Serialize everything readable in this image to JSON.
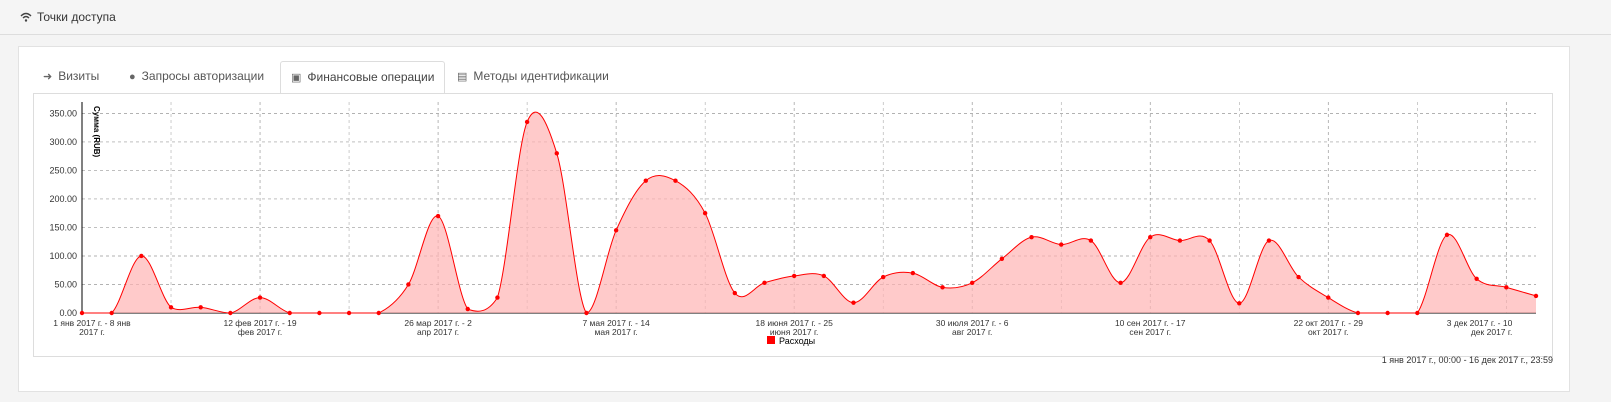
{
  "panel": {
    "title": "Точки доступа",
    "icon": "wifi-icon"
  },
  "tabs": [
    {
      "label": "Визиты",
      "icon": "sign-in-icon",
      "active": false
    },
    {
      "label": "Запросы авторизации",
      "icon": "globe-icon",
      "active": false
    },
    {
      "label": "Финансовые операции",
      "icon": "money-icon",
      "active": true
    },
    {
      "label": "Методы идентификации",
      "icon": "id-card-icon",
      "active": false
    }
  ],
  "date_range": "1 янв 2017 г., 00:00 - 16 дек 2017 г., 23:59",
  "colors": {
    "series": "#ff0000",
    "fill": "#ffb3b3",
    "grid": "#999999"
  },
  "chart_data": {
    "type": "area",
    "ylabel": "Сумма (RUB)",
    "ylim": [
      0,
      370
    ],
    "yticks": [
      "0.00",
      "50.00",
      "100.00",
      "150.00",
      "200.00",
      "250.00",
      "300.00",
      "350.00"
    ],
    "grid": true,
    "legend_position": "bottom-center",
    "categories": [
      [
        "1 янв 2017 г. - 8 янв",
        "2017 г."
      ],
      [
        "12 фев 2017 г. - 19",
        "фев 2017 г."
      ],
      [
        "26 мар 2017 г. - 2",
        "апр 2017 г."
      ],
      [
        "7 мая 2017 г. - 14",
        "мая 2017 г."
      ],
      [
        "18 июня 2017 г. - 25",
        "июня 2017 г."
      ],
      [
        "30 июля 2017 г. - 6",
        "авг 2017 г."
      ],
      [
        "10 сен 2017 г. - 17",
        "сен 2017 г."
      ],
      [
        "22 окт 2017 г. - 29",
        "окт 2017 г."
      ],
      [
        "3 дек 2017 г. - 10",
        "дек 2017 г."
      ]
    ],
    "series": [
      {
        "name": "Расходы",
        "values": [
          0,
          0,
          100,
          10,
          10,
          0,
          27,
          0,
          0,
          0,
          0,
          50,
          170,
          7,
          27,
          335,
          280,
          0,
          145,
          232,
          232,
          175,
          35,
          53,
          65,
          65,
          18,
          63,
          70,
          45,
          53,
          95,
          133,
          120,
          127,
          53,
          133,
          127,
          127,
          17,
          127,
          63,
          27,
          0,
          0,
          0,
          137,
          60,
          45,
          30
        ]
      }
    ]
  }
}
